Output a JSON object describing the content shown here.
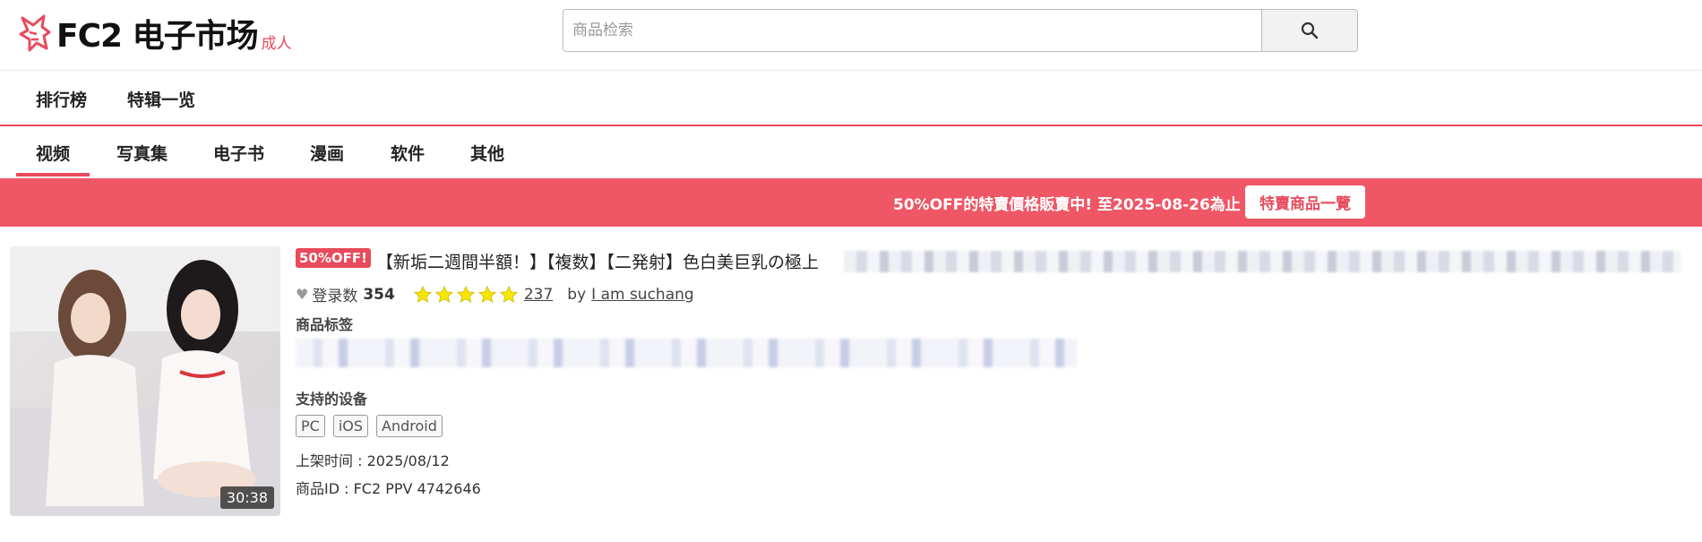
{
  "header": {
    "brand": "FC2 电子市场",
    "adult_label": "成人",
    "search_placeholder": "商品检索"
  },
  "nav_primary": [
    {
      "label": "排行榜"
    },
    {
      "label": "特辑一览"
    }
  ],
  "nav_categories": [
    {
      "label": "视频",
      "active": true
    },
    {
      "label": "写真集"
    },
    {
      "label": "电子书"
    },
    {
      "label": "漫画"
    },
    {
      "label": "软件"
    },
    {
      "label": "其他"
    }
  ],
  "banner": {
    "message": "50%OFF的特賣價格販賣中!  至2025-08-26為止",
    "button_label": "特賣商品一覽",
    "color": "#ef5766"
  },
  "product": {
    "duration": "30:38",
    "discount_badge": "50%OFF!",
    "title": "【新垢二週間半額！】【複数】【二発射】色白美巨乳の極上",
    "favorites_label": "登录数",
    "favorites_count": "354",
    "rating_stars": 5,
    "review_count": "237",
    "by_label": "by",
    "seller": "I am suchang",
    "tags_label": "商品标签",
    "devices_label": "支持的设备",
    "devices": [
      "PC",
      "iOS",
      "Android"
    ],
    "release_date_label": "上架时间 : 2025/08/12",
    "product_id_label": "商品ID : FC2 PPV 4742646"
  },
  "colors": {
    "accent": "#e84b5c",
    "star": "#f7e600"
  }
}
